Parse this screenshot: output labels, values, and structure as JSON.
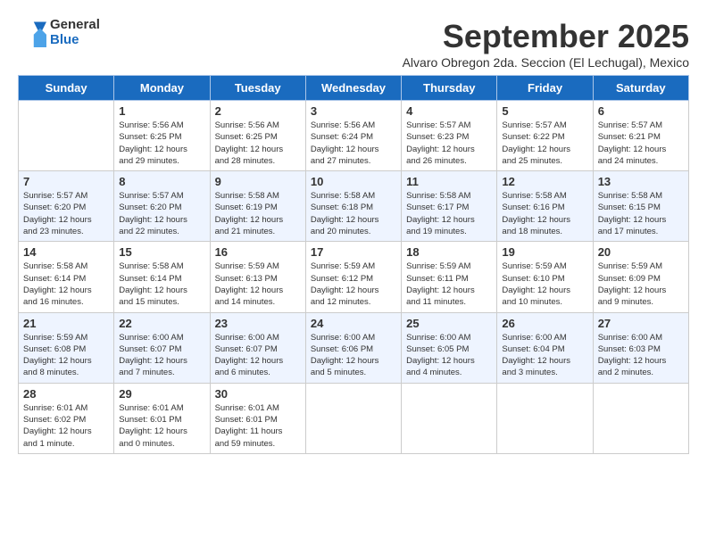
{
  "logo": {
    "general": "General",
    "blue": "Blue"
  },
  "title": "September 2025",
  "subtitle": "Alvaro Obregon 2da. Seccion (El Lechugal), Mexico",
  "days_of_week": [
    "Sunday",
    "Monday",
    "Tuesday",
    "Wednesday",
    "Thursday",
    "Friday",
    "Saturday"
  ],
  "weeks": [
    [
      {
        "day": "",
        "info": ""
      },
      {
        "day": "1",
        "info": "Sunrise: 5:56 AM\nSunset: 6:25 PM\nDaylight: 12 hours\nand 29 minutes."
      },
      {
        "day": "2",
        "info": "Sunrise: 5:56 AM\nSunset: 6:25 PM\nDaylight: 12 hours\nand 28 minutes."
      },
      {
        "day": "3",
        "info": "Sunrise: 5:56 AM\nSunset: 6:24 PM\nDaylight: 12 hours\nand 27 minutes."
      },
      {
        "day": "4",
        "info": "Sunrise: 5:57 AM\nSunset: 6:23 PM\nDaylight: 12 hours\nand 26 minutes."
      },
      {
        "day": "5",
        "info": "Sunrise: 5:57 AM\nSunset: 6:22 PM\nDaylight: 12 hours\nand 25 minutes."
      },
      {
        "day": "6",
        "info": "Sunrise: 5:57 AM\nSunset: 6:21 PM\nDaylight: 12 hours\nand 24 minutes."
      }
    ],
    [
      {
        "day": "7",
        "info": "Sunrise: 5:57 AM\nSunset: 6:20 PM\nDaylight: 12 hours\nand 23 minutes."
      },
      {
        "day": "8",
        "info": "Sunrise: 5:57 AM\nSunset: 6:20 PM\nDaylight: 12 hours\nand 22 minutes."
      },
      {
        "day": "9",
        "info": "Sunrise: 5:58 AM\nSunset: 6:19 PM\nDaylight: 12 hours\nand 21 minutes."
      },
      {
        "day": "10",
        "info": "Sunrise: 5:58 AM\nSunset: 6:18 PM\nDaylight: 12 hours\nand 20 minutes."
      },
      {
        "day": "11",
        "info": "Sunrise: 5:58 AM\nSunset: 6:17 PM\nDaylight: 12 hours\nand 19 minutes."
      },
      {
        "day": "12",
        "info": "Sunrise: 5:58 AM\nSunset: 6:16 PM\nDaylight: 12 hours\nand 18 minutes."
      },
      {
        "day": "13",
        "info": "Sunrise: 5:58 AM\nSunset: 6:15 PM\nDaylight: 12 hours\nand 17 minutes."
      }
    ],
    [
      {
        "day": "14",
        "info": "Sunrise: 5:58 AM\nSunset: 6:14 PM\nDaylight: 12 hours\nand 16 minutes."
      },
      {
        "day": "15",
        "info": "Sunrise: 5:58 AM\nSunset: 6:14 PM\nDaylight: 12 hours\nand 15 minutes."
      },
      {
        "day": "16",
        "info": "Sunrise: 5:59 AM\nSunset: 6:13 PM\nDaylight: 12 hours\nand 14 minutes."
      },
      {
        "day": "17",
        "info": "Sunrise: 5:59 AM\nSunset: 6:12 PM\nDaylight: 12 hours\nand 12 minutes."
      },
      {
        "day": "18",
        "info": "Sunrise: 5:59 AM\nSunset: 6:11 PM\nDaylight: 12 hours\nand 11 minutes."
      },
      {
        "day": "19",
        "info": "Sunrise: 5:59 AM\nSunset: 6:10 PM\nDaylight: 12 hours\nand 10 minutes."
      },
      {
        "day": "20",
        "info": "Sunrise: 5:59 AM\nSunset: 6:09 PM\nDaylight: 12 hours\nand 9 minutes."
      }
    ],
    [
      {
        "day": "21",
        "info": "Sunrise: 5:59 AM\nSunset: 6:08 PM\nDaylight: 12 hours\nand 8 minutes."
      },
      {
        "day": "22",
        "info": "Sunrise: 6:00 AM\nSunset: 6:07 PM\nDaylight: 12 hours\nand 7 minutes."
      },
      {
        "day": "23",
        "info": "Sunrise: 6:00 AM\nSunset: 6:07 PM\nDaylight: 12 hours\nand 6 minutes."
      },
      {
        "day": "24",
        "info": "Sunrise: 6:00 AM\nSunset: 6:06 PM\nDaylight: 12 hours\nand 5 minutes."
      },
      {
        "day": "25",
        "info": "Sunrise: 6:00 AM\nSunset: 6:05 PM\nDaylight: 12 hours\nand 4 minutes."
      },
      {
        "day": "26",
        "info": "Sunrise: 6:00 AM\nSunset: 6:04 PM\nDaylight: 12 hours\nand 3 minutes."
      },
      {
        "day": "27",
        "info": "Sunrise: 6:00 AM\nSunset: 6:03 PM\nDaylight: 12 hours\nand 2 minutes."
      }
    ],
    [
      {
        "day": "28",
        "info": "Sunrise: 6:01 AM\nSunset: 6:02 PM\nDaylight: 12 hours\nand 1 minute."
      },
      {
        "day": "29",
        "info": "Sunrise: 6:01 AM\nSunset: 6:01 PM\nDaylight: 12 hours\nand 0 minutes."
      },
      {
        "day": "30",
        "info": "Sunrise: 6:01 AM\nSunset: 6:01 PM\nDaylight: 11 hours\nand 59 minutes."
      },
      {
        "day": "",
        "info": ""
      },
      {
        "day": "",
        "info": ""
      },
      {
        "day": "",
        "info": ""
      },
      {
        "day": "",
        "info": ""
      }
    ]
  ]
}
